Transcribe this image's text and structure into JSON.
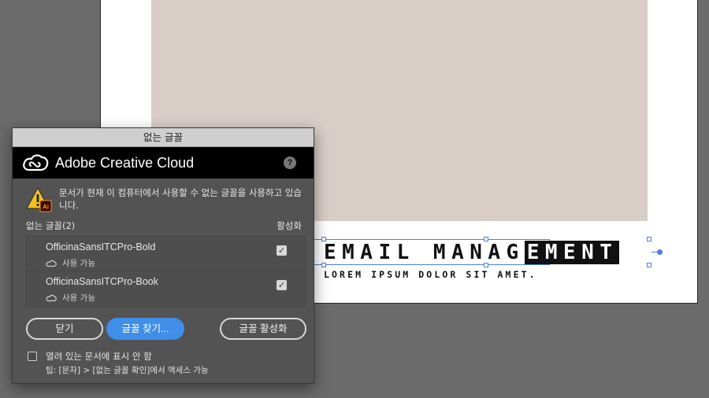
{
  "canvas": {
    "headline_plain": "EMAIL MANAG",
    "headline_selected": "EMENT",
    "subline": "LOREM IPSUM DOLOR SIT AMET."
  },
  "dialog": {
    "title": "없는 글꼴",
    "header": {
      "brand": "Adobe Creative Cloud",
      "help": "?"
    },
    "message": "문서가 현재 이 컴퓨터에서 사용할 수 없는 글꼴을 사용하고 있습니다.",
    "warning_badge": "Ai",
    "list": {
      "header_fonts": "없는 글꼴(2)",
      "header_active": "활성화",
      "rows": [
        {
          "name": "OfficinaSansITCPro-Bold",
          "status": "사용 가능",
          "checked": true
        },
        {
          "name": "OfficinaSansITCPro-Book",
          "status": "사용 가능",
          "checked": true
        }
      ]
    },
    "buttons": {
      "close": "닫기",
      "find": "글꼴 찾기...",
      "activate": "글꼴 활성화"
    },
    "dont_show": "열려 있는 문서에 표시 안 함",
    "tip": "팁: [문자] > [없는 글꼴 확인]에서 액세스 가능"
  },
  "colors": {
    "accent": "#3f8ee8",
    "dialog_bg": "#535353",
    "warning": "#f2c21b",
    "selection": "#4f7fd6"
  },
  "icons": [
    "creative-cloud-logo-icon",
    "help-icon",
    "warning-icon",
    "available-icon",
    "check-icon"
  ]
}
